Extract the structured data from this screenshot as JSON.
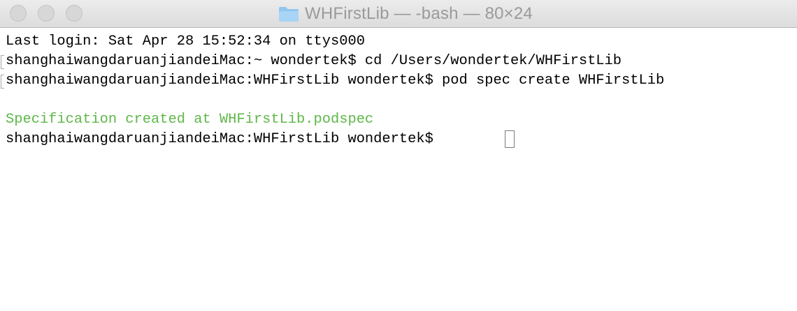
{
  "window": {
    "title": "WHFirstLib — -bash — 80×24",
    "folder_icon": "folder-icon"
  },
  "terminal": {
    "lines": [
      {
        "text": "Last login: Sat Apr 28 15:52:34 on ttys000",
        "marked": false,
        "color": "#000000"
      },
      {
        "text": "shanghaiwangdaruanjiandeiMac:~ wondertek$ cd /Users/wondertek/WHFirstLib",
        "marked": true,
        "color": "#000000"
      },
      {
        "text": "shanghaiwangdaruanjiandeiMac:WHFirstLib wondertek$ pod spec create WHFirstLib",
        "marked": true,
        "color": "#000000"
      },
      {
        "text": "",
        "marked": false,
        "color": "#000000"
      },
      {
        "text": "Specification created at WHFirstLib.podspec",
        "marked": false,
        "color": "#5fb74a"
      },
      {
        "text": "shanghaiwangdaruanjiandeiMac:WHFirstLib wondertek$ ",
        "marked": false,
        "color": "#000000"
      }
    ]
  }
}
